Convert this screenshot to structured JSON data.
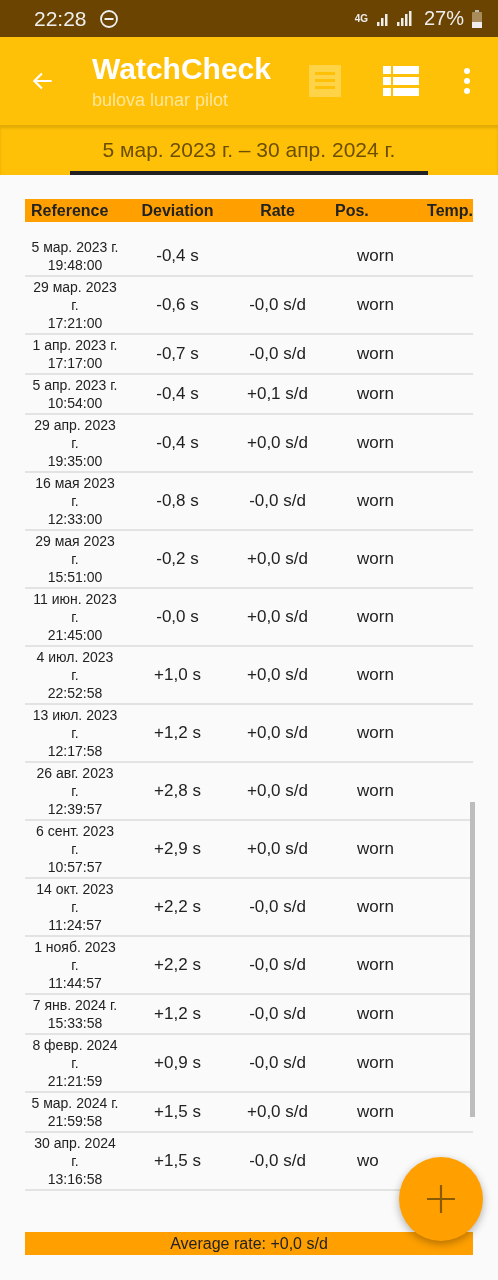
{
  "status_bar": {
    "time": "22:28",
    "network": "4G",
    "battery": "27%"
  },
  "toolbar": {
    "title": "WatchCheck",
    "subtitle": "bulova lunar pilot"
  },
  "date_range": "5 мар. 2023 г. – 30 апр. 2024 г.",
  "table": {
    "columns": [
      "Reference",
      "Deviation",
      "Rate",
      "Pos.",
      "Temp."
    ],
    "rows": [
      {
        "reference": [
          "5 мар. 2023 г.",
          "19:48:00"
        ],
        "deviation": "-0,4 s",
        "position": "worn"
      },
      {
        "reference": [
          "29 мар. 2023",
          "г.",
          "17:21:00"
        ],
        "deviation": "-0,6 s",
        "rate": "-0,0 s/d",
        "position": "worn"
      },
      {
        "reference": [
          "1 апр. 2023 г.",
          "17:17:00"
        ],
        "deviation": "-0,7 s",
        "rate": "-0,0 s/d",
        "position": "worn"
      },
      {
        "reference": [
          "5 апр. 2023 г.",
          "10:54:00"
        ],
        "deviation": "-0,4 s",
        "rate": "+0,1 s/d",
        "position": "worn"
      },
      {
        "reference": [
          "29 апр. 2023",
          "г.",
          "19:35:00"
        ],
        "deviation": "-0,4 s",
        "rate": "+0,0 s/d",
        "position": "worn"
      },
      {
        "reference": [
          "16 мая 2023",
          "г.",
          "12:33:00"
        ],
        "deviation": "-0,8 s",
        "rate": "-0,0 s/d",
        "position": "worn"
      },
      {
        "reference": [
          "29 мая 2023",
          "г.",
          "15:51:00"
        ],
        "deviation": "-0,2 s",
        "rate": "+0,0 s/d",
        "position": "worn"
      },
      {
        "reference": [
          "11 июн. 2023",
          "г.",
          "21:45:00"
        ],
        "deviation": "-0,0 s",
        "rate": "+0,0 s/d",
        "position": "worn"
      },
      {
        "reference": [
          "4 июл. 2023",
          "г.",
          "22:52:58"
        ],
        "deviation": "+1,0 s",
        "rate": "+0,0 s/d",
        "position": "worn"
      },
      {
        "reference": [
          "13 июл. 2023",
          "г.",
          "12:17:58"
        ],
        "deviation": "+1,2 s",
        "rate": "+0,0 s/d",
        "position": "worn"
      },
      {
        "reference": [
          "26 авг. 2023",
          "г.",
          "12:39:57"
        ],
        "deviation": "+2,8 s",
        "rate": "+0,0 s/d",
        "position": "worn"
      },
      {
        "reference": [
          "6 сент. 2023",
          "г.",
          "10:57:57"
        ],
        "deviation": "+2,9 s",
        "rate": "+0,0 s/d",
        "position": "worn"
      },
      {
        "reference": [
          "14 окт. 2023",
          "г.",
          "11:24:57"
        ],
        "deviation": "+2,2 s",
        "rate": "-0,0 s/d",
        "position": "worn"
      },
      {
        "reference": [
          "1 нояб. 2023",
          "г.",
          "11:44:57"
        ],
        "deviation": "+2,2 s",
        "rate": "-0,0 s/d",
        "position": "worn"
      },
      {
        "reference": [
          "7 янв. 2024 г.",
          "15:33:58"
        ],
        "deviation": "+1,2 s",
        "rate": "-0,0 s/d",
        "position": "worn"
      },
      {
        "reference": [
          "8 февр. 2024",
          "г.",
          "21:21:59"
        ],
        "deviation": "+0,9 s",
        "rate": "-0,0 s/d",
        "position": "worn"
      },
      {
        "reference": [
          "5 мар. 2024 г.",
          "21:59:58"
        ],
        "deviation": "+1,5 s",
        "rate": "+0,0 s/d",
        "position": "worn"
      },
      {
        "reference": [
          "30 апр. 2024",
          "г.",
          "13:16:58"
        ],
        "deviation": "+1,5 s",
        "rate": "-0,0 s/d",
        "position": "wo"
      }
    ]
  },
  "average": "Average rate: +0,0 s/d"
}
